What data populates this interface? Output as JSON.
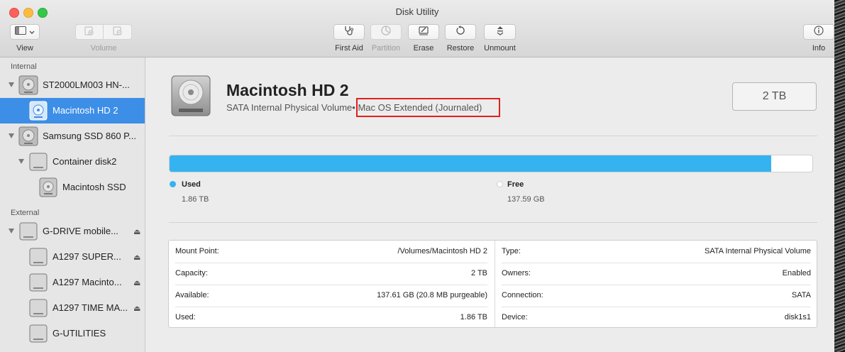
{
  "window": {
    "title": "Disk Utility"
  },
  "toolbar": {
    "view_label": "View",
    "volume_label": "Volume",
    "first_aid_label": "First Aid",
    "partition_label": "Partition",
    "erase_label": "Erase",
    "restore_label": "Restore",
    "unmount_label": "Unmount",
    "info_label": "Info"
  },
  "sidebar": {
    "internal_header": "Internal",
    "external_header": "External",
    "items": [
      {
        "label": "ST2000LM003 HN-...",
        "icon": "hard-drive-icon"
      },
      {
        "label": "Macintosh HD 2",
        "icon": "volume-icon",
        "selected": true
      },
      {
        "label": "Samsung SSD 860 P...",
        "icon": "hard-drive-icon"
      },
      {
        "label": "Container disk2",
        "icon": "container-icon"
      },
      {
        "label": "Macintosh SSD",
        "icon": "volume-icon"
      },
      {
        "label": "G-DRIVE mobile...",
        "icon": "external-drive-icon"
      },
      {
        "label": "A1297 SUPER...",
        "icon": "external-volume-icon"
      },
      {
        "label": "A1297 Macinto...",
        "icon": "external-volume-icon"
      },
      {
        "label": "A1297 TIME MA...",
        "icon": "external-volume-icon"
      },
      {
        "label": "G-UTILITIES",
        "icon": "external-volume-icon"
      }
    ]
  },
  "volume": {
    "name": "Macintosh HD 2",
    "subtitle_type": "SATA Internal Physical Volume",
    "subtitle_fs": "• Mac OS Extended (Journaled)",
    "capacity_badge": "2 TB"
  },
  "usage": {
    "used_fraction": 0.936,
    "used_label": "Used",
    "used_value": "1.86 TB",
    "free_label": "Free",
    "free_value": "137.59 GB",
    "used_color": "#35b3f1",
    "free_color": "#ffffff"
  },
  "info": {
    "left": [
      {
        "key": "Mount Point:",
        "value": "/Volumes/Macintosh HD 2"
      },
      {
        "key": "Capacity:",
        "value": "2 TB"
      },
      {
        "key": "Available:",
        "value": "137.61 GB (20.8 MB purgeable)"
      },
      {
        "key": "Used:",
        "value": "1.86 TB"
      }
    ],
    "right": [
      {
        "key": "Type:",
        "value": "SATA Internal Physical Volume"
      },
      {
        "key": "Owners:",
        "value": "Enabled"
      },
      {
        "key": "Connection:",
        "value": "SATA"
      },
      {
        "key": "Device:",
        "value": "disk1s1"
      }
    ]
  }
}
